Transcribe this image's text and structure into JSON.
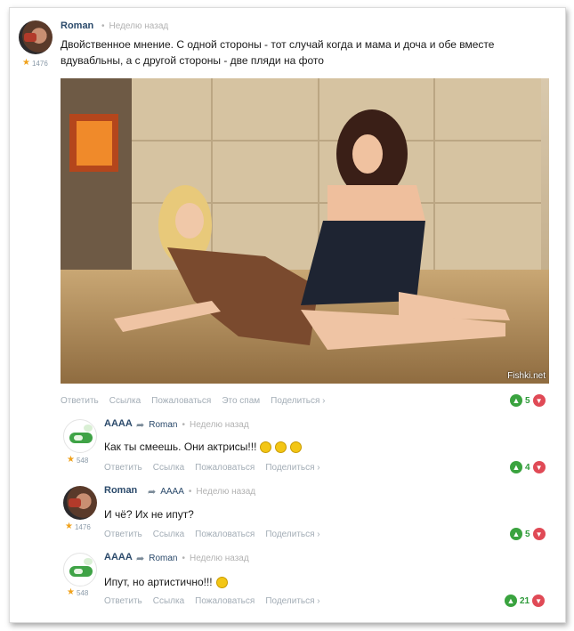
{
  "post": {
    "author": "Roman",
    "time": "Неделю назад",
    "rating": "1476",
    "text": "Двойственное мнение. С одной стороны - тот случай когда и мама и доча и обе вместе вдувабльны, а с другой стороны - две пляди на фото",
    "watermark": "Fishki.net",
    "actions": [
      "Ответить",
      "Ссылка",
      "Пожаловаться",
      "Это спам",
      "Поделиться ›"
    ],
    "votes": "5"
  },
  "replies": [
    {
      "author": "AAAA",
      "reply_to": "Roman",
      "time": "Неделю назад",
      "rating": "548",
      "text": "Как ты смеешь. Они актрисы!!!",
      "smileys": 3,
      "actions": [
        "Ответить",
        "Ссылка",
        "Пожаловаться",
        "Поделиться ›"
      ],
      "votes": "4"
    },
    {
      "author": "Roman",
      "reply_to": "AAAA",
      "time": "Неделю назад",
      "rating": "1476",
      "text": "И чё? Их не ипут?",
      "smileys": 0,
      "actions": [
        "Ответить",
        "Ссылка",
        "Пожаловаться",
        "Поделиться ›"
      ],
      "votes": "5"
    },
    {
      "author": "AAAA",
      "reply_to": "Roman",
      "time": "Неделю назад",
      "rating": "548",
      "text": "Ипут, но артистично!!!",
      "smileys": 1,
      "actions": [
        "Ответить",
        "Ссылка",
        "Пожаловаться",
        "Поделиться ›"
      ],
      "votes": "21"
    }
  ],
  "colors": {
    "name": "#2b4a6b",
    "upvote": "#3aa33f",
    "downvote": "#e04a56",
    "star": "#f0a21c"
  }
}
